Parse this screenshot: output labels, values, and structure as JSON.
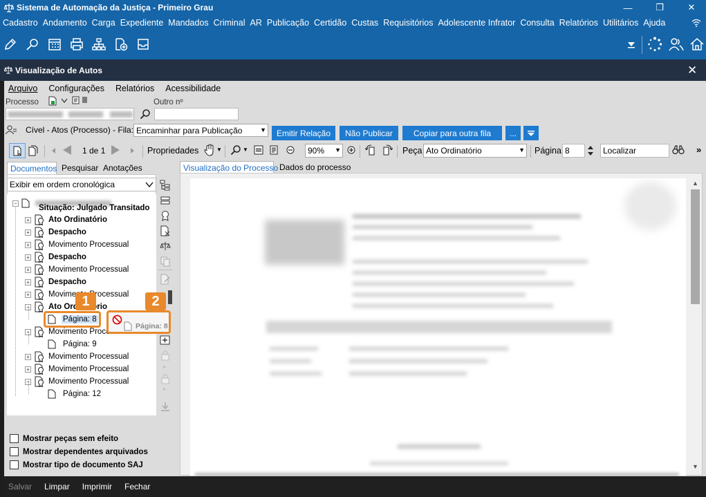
{
  "app": {
    "title": "Sistema de Automação da Justiça - Primeiro Grau"
  },
  "main_menu": [
    "Cadastro",
    "Andamento",
    "Carga",
    "Expediente",
    "Mandados",
    "Criminal",
    "AR",
    "Publicação",
    "Certidão",
    "Custas",
    "Requisitórios",
    "Adolescente Infrator",
    "Consulta",
    "Relatórios",
    "Utilitários",
    "Ajuda"
  ],
  "child_window": {
    "title": "Visualização de Autos"
  },
  "child_menu": [
    "Arquivo",
    "Configurações",
    "Relatórios",
    "Acessibilidade"
  ],
  "process": {
    "label": "Processo",
    "other_label": "Outro nº"
  },
  "queue": {
    "label": "Cível - Atos (Processo) - Fila:",
    "selected": "Encaminhar para Publicação",
    "buttons": {
      "emit": "Emitir Relação",
      "no_publish": "Não Publicar",
      "copy": "Copiar para outra fila",
      "more": "..."
    }
  },
  "viewer_toolbar": {
    "page_nav": "1 de 1",
    "properties": "Propriedades",
    "zoom": "90%",
    "piece_label": "Peça",
    "piece_value": "Ato Ordinatório",
    "page_label": "Página",
    "page_value": "8",
    "search_placeholder": "Localizar"
  },
  "left_tabs": [
    "Documentos",
    "Pesquisar",
    "Anotações"
  ],
  "order_select": "Exibir em ordem cronológica",
  "tree": {
    "status": "Situação: Julgado Transitado",
    "items": [
      {
        "label": "Ato Ordinatório",
        "bold": true
      },
      {
        "label": "Despacho",
        "bold": true
      },
      {
        "label": "Movimento Processual",
        "bold": false
      },
      {
        "label": "Despacho",
        "bold": true
      },
      {
        "label": "Movimento Processual",
        "bold": false
      },
      {
        "label": "Despacho",
        "bold": true
      },
      {
        "label": "Movimento Processual",
        "bold": false
      },
      {
        "label": "Ato Ordinatório",
        "bold": true
      },
      {
        "label": "Movimento Processual",
        "bold": false
      },
      {
        "label": "Movimento Processual",
        "bold": false
      },
      {
        "label": "Movimento Processual",
        "bold": false
      },
      {
        "label": "Movimento Processual",
        "bold": false
      }
    ],
    "page_8": "Página: 8",
    "page_9": "Página: 9",
    "page_12": "Página: 12",
    "drag_ghost": "Página: 8"
  },
  "badges": {
    "one": "1",
    "two": "2"
  },
  "checkboxes": [
    "Mostrar peças sem efeito",
    "Mostrar dependentes arquivados",
    "Mostrar tipo de documento SAJ"
  ],
  "right_tabs": [
    "Visualização do Processo",
    "Dados do processo"
  ],
  "bottom_buttons": [
    "Salvar",
    "Limpar",
    "Imprimir",
    "Fechar"
  ],
  "colors": {
    "titlebar": "#1565a8",
    "accent": "#1e7bd0",
    "highlight": "#e8892b",
    "dark": "#233043"
  }
}
